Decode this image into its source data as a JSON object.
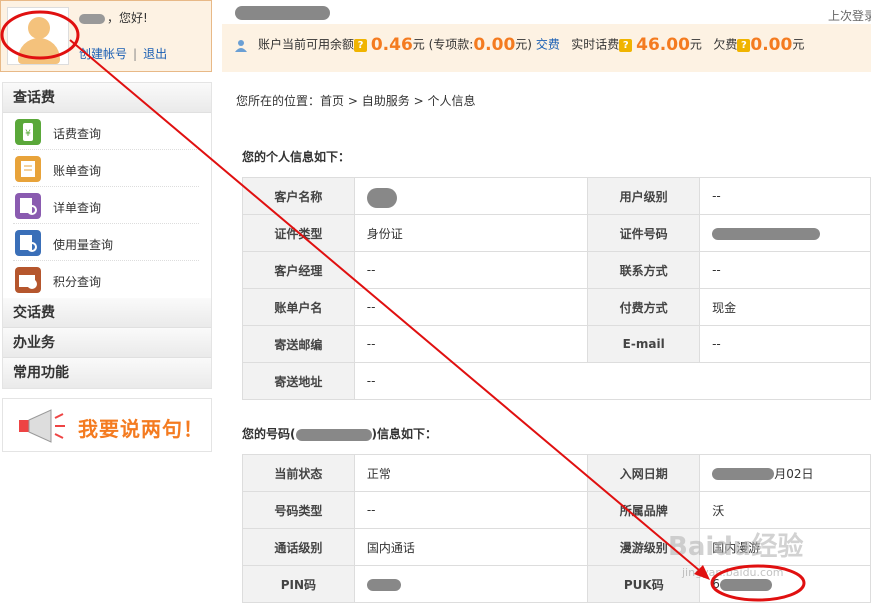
{
  "user": {
    "greeting": "，您好!",
    "create_account": "创建帐号",
    "separator": "|",
    "logout": "退出"
  },
  "menu": {
    "sections": [
      {
        "title": "查话费"
      },
      {
        "title": "交话费"
      },
      {
        "title": "办业务"
      },
      {
        "title": "常用功能"
      }
    ],
    "items": [
      {
        "label": "话费查询",
        "icon": "phone-bill-icon",
        "color": "#5aa83a"
      },
      {
        "label": "账单查询",
        "icon": "bill-icon",
        "color": "#e8a33a"
      },
      {
        "label": "详单查询",
        "icon": "detail-list-icon",
        "color": "#8a5bb0"
      },
      {
        "label": "使用量查询",
        "icon": "usage-icon",
        "color": "#3a6fb8"
      },
      {
        "label": "积分查询",
        "icon": "points-icon",
        "color": "#b5562d"
      }
    ]
  },
  "ad": {
    "text": "我要说两句！"
  },
  "header": {
    "last_login": "上次登录"
  },
  "balance": {
    "label1": "账户当前可用余额",
    "amount1": "0.46",
    "unit1": "元 (专项款:",
    "amount2": "0.00",
    "unit2": "元)",
    "pay_link": "交费",
    "label2": "实时话费",
    "amount3": "46.00",
    "unit3": "元",
    "label3": "欠费",
    "amount4": "0.00",
    "unit4": "元",
    "q": "?"
  },
  "breadcrumb": {
    "prefix": "您所在的位置：",
    "home": "首页",
    "sep": ">",
    "self_service": "自助服务",
    "current": "个人信息"
  },
  "personal": {
    "title": "您的个人信息如下：",
    "rows": [
      [
        "客户名称",
        "",
        "用户级别",
        "--"
      ],
      [
        "证件类型",
        "身份证",
        "证件号码",
        ""
      ],
      [
        "客户经理",
        "--",
        "联系方式",
        "--"
      ],
      [
        "账单户名",
        "--",
        "付费方式",
        "现金"
      ],
      [
        "寄送邮编",
        "--",
        "E-mail",
        "--"
      ],
      [
        "寄送地址",
        "--"
      ]
    ]
  },
  "number_info": {
    "title_prefix": "您的号码(",
    "title_suffix": ")信息如下：",
    "rows": [
      [
        "当前状态",
        "正常",
        "入网日期",
        "月02日"
      ],
      [
        "号码类型",
        "--",
        "所属品牌",
        "沃"
      ],
      [
        "通话级别",
        "国内通话",
        "漫游级别",
        "国内漫游"
      ],
      [
        "PIN码",
        "",
        "PUK码",
        "6"
      ]
    ]
  },
  "watermark": {
    "text": "Baidu经验",
    "sub": "jingyan.baidu.com"
  },
  "colors": {
    "accent": "#f47b20",
    "link": "#1a5fb4",
    "annotation": "#e01010"
  }
}
